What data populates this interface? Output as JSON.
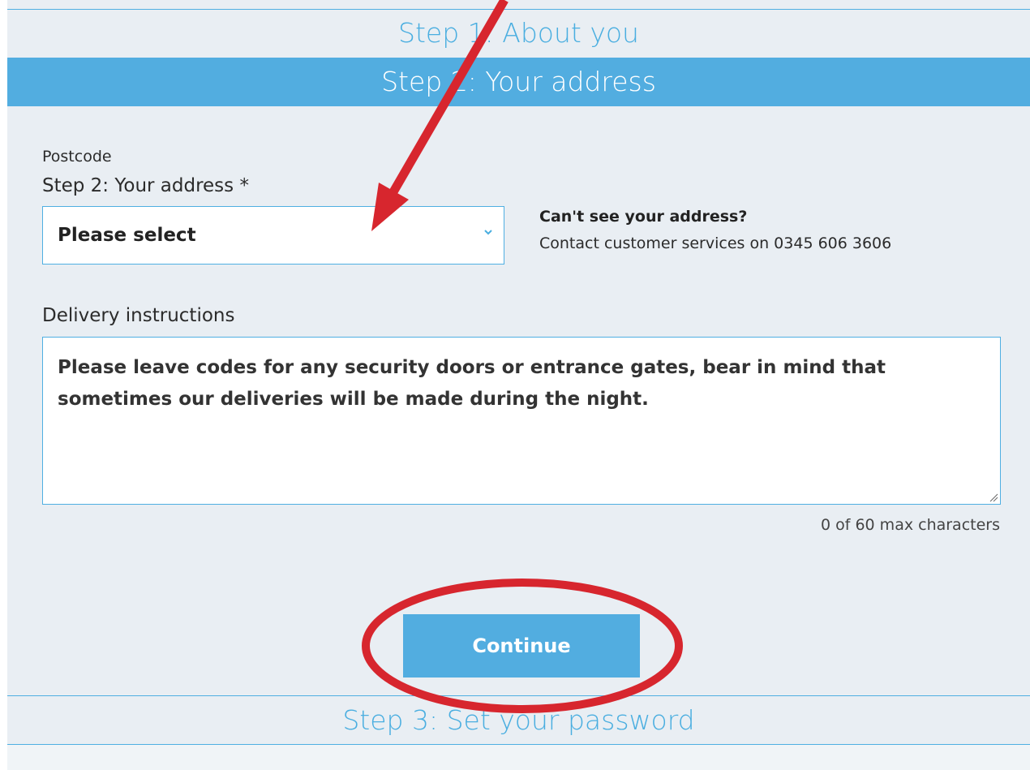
{
  "steps": {
    "step1": "Step 1: About you",
    "step2": "Step 2: Your address",
    "step3": "Step 3: Set your password"
  },
  "form": {
    "postcode_label": "Postcode",
    "address_label": "Step 2: Your address *",
    "address_select_value": "Please select",
    "help_title": "Can't see your address?",
    "help_text": "Contact customer services on 0345 606 3606",
    "delivery_label": "Delivery instructions",
    "delivery_placeholder": "Please leave codes for any security doors or entrance gates, bear in mind that sometimes our deliveries will be made during the night.",
    "char_count": "0 of 60 max characters",
    "continue_label": "Continue"
  },
  "colors": {
    "accent": "#52ade0",
    "panel": "#e9eef3",
    "annotation": "#d7262e"
  }
}
